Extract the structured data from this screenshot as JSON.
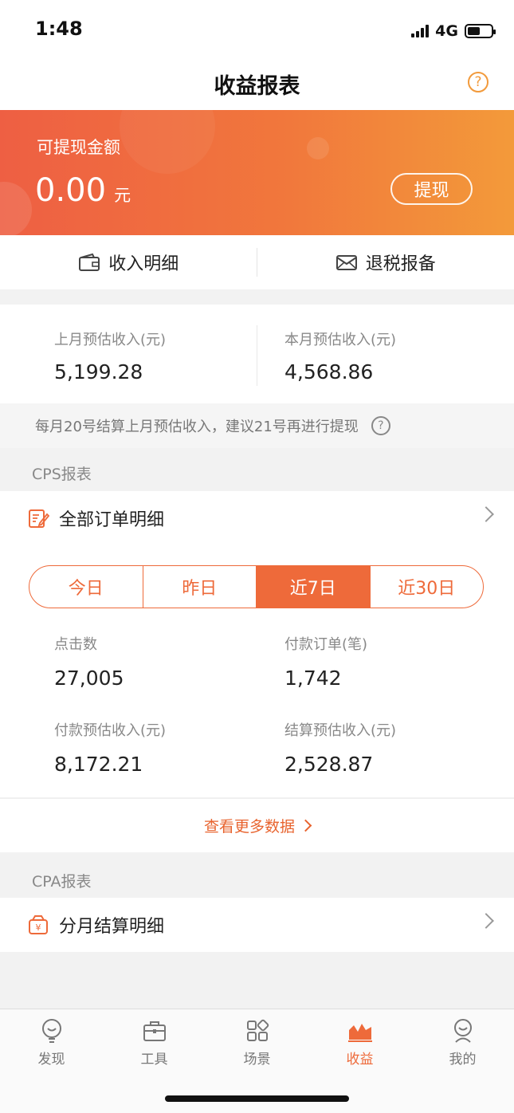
{
  "status_bar": {
    "time": "1:48",
    "network": "4G"
  },
  "header": {
    "title": "收益报表",
    "help_label": "?"
  },
  "banner": {
    "label": "可提现金额",
    "amount": "0.00",
    "unit": "元",
    "withdraw_label": "提现"
  },
  "quick_links": [
    {
      "label": "收入明细",
      "icon": "wallet-icon"
    },
    {
      "label": "退税报备",
      "icon": "envelope-icon"
    }
  ],
  "estimates": {
    "last_month": {
      "label": "上月预估收入(元)",
      "value": "5,199.28"
    },
    "this_month": {
      "label": "本月预估收入(元)",
      "value": "4,568.86"
    }
  },
  "notice": {
    "text": "每月20号结算上月预估收入，建议21号再进行提现",
    "help_label": "?"
  },
  "cps": {
    "section_title": "CPS报表",
    "all_orders_label": "全部订单明细",
    "segments": [
      "今日",
      "昨日",
      "近7日",
      "近30日"
    ],
    "active_segment": "近7日",
    "stats": {
      "clicks": {
        "label": "点击数",
        "value": "27,005"
      },
      "paid_orders": {
        "label": "付款订单(笔)",
        "value": "1,742"
      },
      "paid_income": {
        "label": "付款预估收入(元)",
        "value": "8,172.21"
      },
      "settled_income": {
        "label": "结算预估收入(元)",
        "value": "2,528.87"
      }
    },
    "more_label": "查看更多数据"
  },
  "cpa": {
    "section_title": "CPA报表",
    "monthly_label": "分月结算明细"
  },
  "tabbar": {
    "tabs": [
      {
        "label": "发现",
        "icon": "lightbulb-icon"
      },
      {
        "label": "工具",
        "icon": "toolbox-icon"
      },
      {
        "label": "场景",
        "icon": "grid-icon"
      },
      {
        "label": "收益",
        "icon": "area-chart-icon"
      },
      {
        "label": "我的",
        "icon": "person-icon"
      }
    ],
    "active": "收益"
  },
  "colors": {
    "accent": "#ee6a3a",
    "banner_start": "#ee5f43",
    "banner_end": "#f39a3a"
  }
}
